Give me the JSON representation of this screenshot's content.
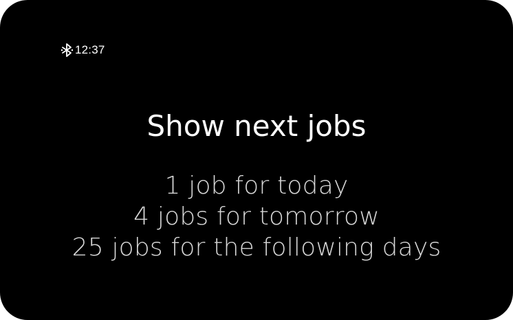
{
  "status_bar": {
    "icon": "bluetooth-icon",
    "time": "12:37"
  },
  "main": {
    "title": "Show next jobs",
    "jobs": [
      "1 job for today",
      "4 jobs for tomorrow",
      "25 jobs for the following days"
    ]
  },
  "colors": {
    "background": "#000000",
    "title_text": "#ffffff",
    "body_text": "#d6d6d6"
  }
}
